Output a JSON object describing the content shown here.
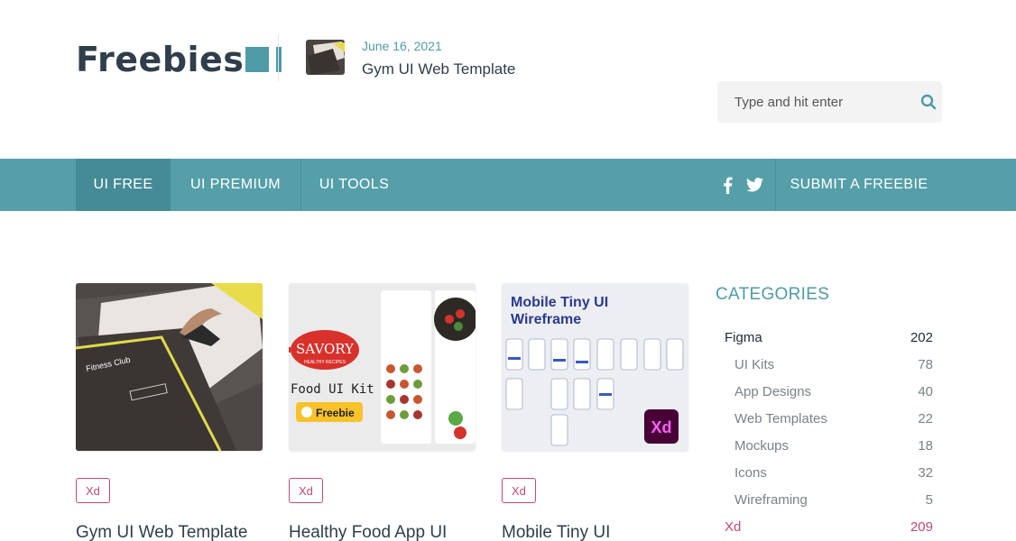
{
  "brand": {
    "name": "Freebies",
    "accent": "#4f9ba6"
  },
  "latest_post": {
    "date": "June 16, 2021",
    "title": "Gym UI Web Template"
  },
  "search": {
    "placeholder": "Type and hit enter"
  },
  "nav": {
    "items": [
      {
        "label": "UI FREE",
        "active": true
      },
      {
        "label": "UI PREMIUM",
        "active": false
      },
      {
        "label": "UI TOOLS",
        "active": false
      }
    ],
    "submit_label": "SUBMIT A FREEBIE",
    "social_icons": [
      "facebook-icon",
      "twitter-icon"
    ],
    "color": "#559fa9"
  },
  "posts": [
    {
      "tag": "Xd",
      "title": "Gym UI Web Template",
      "thumb_text": "Fitness Club"
    },
    {
      "tag": "Xd",
      "title": "Healthy Food App UI",
      "thumb_brand": "SAVORY",
      "thumb_sub": "HEALTHY RECIPES",
      "thumb_kit": "Food UI Kit",
      "thumb_badge": "Freebie"
    },
    {
      "tag": "Xd",
      "title": "Mobile Tiny UI",
      "thumb_line1": "Mobile Tiny UI",
      "thumb_line2": "Wireframe",
      "thumb_badge": "Xd"
    }
  ],
  "categories": {
    "heading": "CATEGORIES",
    "items": [
      {
        "name": "Figma",
        "count": "202",
        "level": "main"
      },
      {
        "name": "UI Kits",
        "count": "78",
        "level": "sub"
      },
      {
        "name": "App Designs",
        "count": "40",
        "level": "sub"
      },
      {
        "name": "Web Templates",
        "count": "22",
        "level": "sub"
      },
      {
        "name": "Mockups",
        "count": "18",
        "level": "sub"
      },
      {
        "name": "Icons",
        "count": "32",
        "level": "sub"
      },
      {
        "name": "Wireframing",
        "count": "5",
        "level": "sub"
      },
      {
        "name": "Xd",
        "count": "209",
        "level": "main"
      }
    ]
  }
}
